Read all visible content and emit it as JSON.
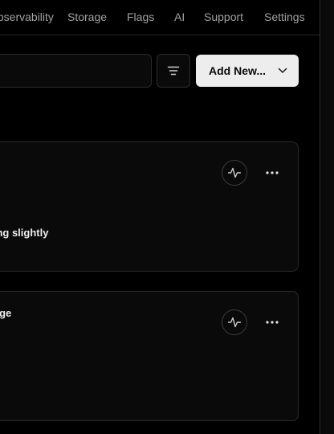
{
  "nav": {
    "tabs": [
      "Observability",
      "Storage",
      "Flags",
      "AI",
      "Support",
      "Settings"
    ]
  },
  "toolbar": {
    "filter_icon": "filter-icon",
    "add_label": "Add New...",
    "add_icon": "chevron-down-icon"
  },
  "cards": [
    {
      "title": "...ing slightly",
      "actions": [
        "activity-icon",
        "more-icon"
      ]
    },
    {
      "title": "...age",
      "actions": [
        "activity-icon",
        "more-icon"
      ]
    }
  ],
  "colors": {
    "background": "#000000",
    "surface": "#0a0a0a",
    "border": "#2a2a2a",
    "text": "#ededed",
    "muted": "#a1a1a1",
    "button_bg": "#ededed"
  }
}
